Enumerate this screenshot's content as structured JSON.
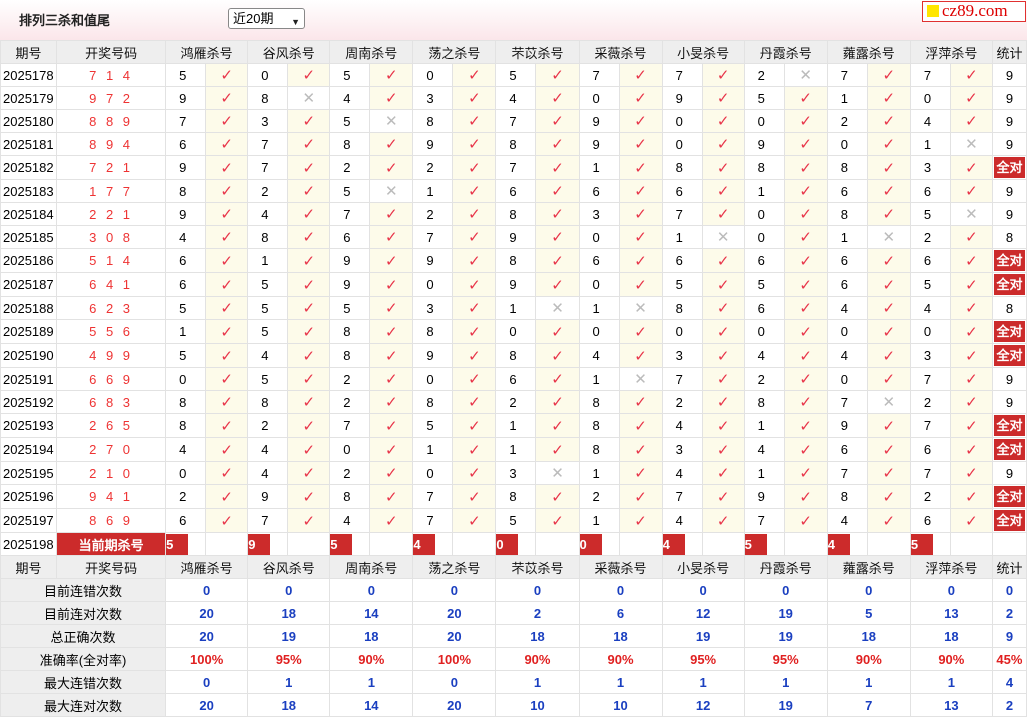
{
  "header": {
    "title": "排列三杀和值尾",
    "period_select": "近20期",
    "logo": "cz89.com"
  },
  "columns": {
    "period": "期号",
    "draw": "开奖号码",
    "experts": [
      "鸿雁杀号",
      "谷风杀号",
      "周南杀号",
      "荡之杀号",
      "芣苡杀号",
      "采薇杀号",
      "小旻杀号",
      "丹霞杀号",
      "蕹露杀号",
      "浮萍杀号"
    ],
    "stat": "统计"
  },
  "rows": [
    {
      "period": "2025178",
      "draw": "7 1 4",
      "nums": [
        "5",
        "0",
        "5",
        "0",
        "5",
        "7",
        "7",
        "2",
        "7",
        "7"
      ],
      "hits": [
        1,
        1,
        1,
        1,
        1,
        1,
        1,
        0,
        1,
        1
      ],
      "stat": "9"
    },
    {
      "period": "2025179",
      "draw": "9 7 2",
      "nums": [
        "9",
        "8",
        "4",
        "3",
        "4",
        "0",
        "9",
        "5",
        "1",
        "0"
      ],
      "hits": [
        1,
        0,
        1,
        1,
        1,
        1,
        1,
        1,
        1,
        1
      ],
      "stat": "9"
    },
    {
      "period": "2025180",
      "draw": "8 8 9",
      "nums": [
        "7",
        "3",
        "5",
        "8",
        "7",
        "9",
        "0",
        "0",
        "2",
        "4"
      ],
      "hits": [
        1,
        1,
        0,
        1,
        1,
        1,
        1,
        1,
        1,
        1
      ],
      "stat": "9"
    },
    {
      "period": "2025181",
      "draw": "8 9 4",
      "nums": [
        "6",
        "7",
        "8",
        "9",
        "8",
        "9",
        "0",
        "9",
        "0",
        "1"
      ],
      "hits": [
        1,
        1,
        1,
        1,
        1,
        1,
        1,
        1,
        1,
        0
      ],
      "stat": "9"
    },
    {
      "period": "2025182",
      "draw": "7 2 1",
      "nums": [
        "9",
        "7",
        "2",
        "2",
        "7",
        "1",
        "8",
        "8",
        "8",
        "3"
      ],
      "hits": [
        1,
        1,
        1,
        1,
        1,
        1,
        1,
        1,
        1,
        1
      ],
      "stat": "全对"
    },
    {
      "period": "2025183",
      "draw": "1 7 7",
      "nums": [
        "8",
        "2",
        "5",
        "1",
        "6",
        "6",
        "6",
        "1",
        "6",
        "6"
      ],
      "hits": [
        1,
        1,
        0,
        1,
        1,
        1,
        1,
        1,
        1,
        1
      ],
      "stat": "9"
    },
    {
      "period": "2025184",
      "draw": "2 2 1",
      "nums": [
        "9",
        "4",
        "7",
        "2",
        "8",
        "3",
        "7",
        "0",
        "8",
        "5"
      ],
      "hits": [
        1,
        1,
        1,
        1,
        1,
        1,
        1,
        1,
        1,
        0
      ],
      "stat": "9"
    },
    {
      "period": "2025185",
      "draw": "3 0 8",
      "nums": [
        "4",
        "8",
        "6",
        "7",
        "9",
        "0",
        "1",
        "0",
        "1",
        "2"
      ],
      "hits": [
        1,
        1,
        1,
        1,
        1,
        1,
        0,
        1,
        0,
        1
      ],
      "stat": "8"
    },
    {
      "period": "2025186",
      "draw": "5 1 4",
      "nums": [
        "6",
        "1",
        "9",
        "9",
        "8",
        "6",
        "6",
        "6",
        "6",
        "6"
      ],
      "hits": [
        1,
        1,
        1,
        1,
        1,
        1,
        1,
        1,
        1,
        1
      ],
      "stat": "全对"
    },
    {
      "period": "2025187",
      "draw": "6 4 1",
      "nums": [
        "6",
        "5",
        "9",
        "0",
        "9",
        "0",
        "5",
        "5",
        "6",
        "5"
      ],
      "hits": [
        1,
        1,
        1,
        1,
        1,
        1,
        1,
        1,
        1,
        1
      ],
      "stat": "全对"
    },
    {
      "period": "2025188",
      "draw": "6 2 3",
      "nums": [
        "5",
        "5",
        "5",
        "3",
        "1",
        "1",
        "8",
        "6",
        "4",
        "4"
      ],
      "hits": [
        1,
        1,
        1,
        1,
        0,
        0,
        1,
        1,
        1,
        1
      ],
      "stat": "8"
    },
    {
      "period": "2025189",
      "draw": "5 5 6",
      "nums": [
        "1",
        "5",
        "8",
        "8",
        "0",
        "0",
        "0",
        "0",
        "0",
        "0"
      ],
      "hits": [
        1,
        1,
        1,
        1,
        1,
        1,
        1,
        1,
        1,
        1
      ],
      "stat": "全对"
    },
    {
      "period": "2025190",
      "draw": "4 9 9",
      "nums": [
        "5",
        "4",
        "8",
        "9",
        "8",
        "4",
        "3",
        "4",
        "4",
        "3"
      ],
      "hits": [
        1,
        1,
        1,
        1,
        1,
        1,
        1,
        1,
        1,
        1
      ],
      "stat": "全对"
    },
    {
      "period": "2025191",
      "draw": "6 6 9",
      "nums": [
        "0",
        "5",
        "2",
        "0",
        "6",
        "1",
        "7",
        "2",
        "0",
        "7"
      ],
      "hits": [
        1,
        1,
        1,
        1,
        1,
        0,
        1,
        1,
        1,
        1
      ],
      "stat": "9"
    },
    {
      "period": "2025192",
      "draw": "6 8 3",
      "nums": [
        "8",
        "8",
        "2",
        "8",
        "2",
        "8",
        "2",
        "8",
        "7",
        "2"
      ],
      "hits": [
        1,
        1,
        1,
        1,
        1,
        1,
        1,
        1,
        0,
        1
      ],
      "stat": "9"
    },
    {
      "period": "2025193",
      "draw": "2 6 5",
      "nums": [
        "8",
        "2",
        "7",
        "5",
        "1",
        "8",
        "4",
        "1",
        "9",
        "7"
      ],
      "hits": [
        1,
        1,
        1,
        1,
        1,
        1,
        1,
        1,
        1,
        1
      ],
      "stat": "全对"
    },
    {
      "period": "2025194",
      "draw": "2 7 0",
      "nums": [
        "4",
        "4",
        "0",
        "1",
        "1",
        "8",
        "3",
        "4",
        "6",
        "6"
      ],
      "hits": [
        1,
        1,
        1,
        1,
        1,
        1,
        1,
        1,
        1,
        1
      ],
      "stat": "全对"
    },
    {
      "period": "2025195",
      "draw": "2 1 0",
      "nums": [
        "0",
        "4",
        "2",
        "0",
        "3",
        "1",
        "4",
        "1",
        "7",
        "7"
      ],
      "hits": [
        1,
        1,
        1,
        1,
        0,
        1,
        1,
        1,
        1,
        1
      ],
      "stat": "9"
    },
    {
      "period": "2025196",
      "draw": "9 4 1",
      "nums": [
        "2",
        "9",
        "8",
        "7",
        "8",
        "2",
        "7",
        "9",
        "8",
        "2"
      ],
      "hits": [
        1,
        1,
        1,
        1,
        1,
        1,
        1,
        1,
        1,
        1
      ],
      "stat": "全对"
    },
    {
      "period": "2025197",
      "draw": "8 6 9",
      "nums": [
        "6",
        "7",
        "4",
        "7",
        "5",
        "1",
        "4",
        "7",
        "4",
        "6"
      ],
      "hits": [
        1,
        1,
        1,
        1,
        1,
        1,
        1,
        1,
        1,
        1
      ],
      "stat": "全对"
    }
  ],
  "current": {
    "period": "2025198",
    "label": "当前期杀号",
    "nums": [
      "5",
      "9",
      "5",
      "4",
      "0",
      "0",
      "4",
      "5",
      "4",
      "5"
    ]
  },
  "summary": [
    {
      "label": "目前连错次数",
      "values": [
        "0",
        "0",
        "0",
        "0",
        "0",
        "0",
        "0",
        "0",
        "0",
        "0"
      ],
      "stat": "0",
      "red": false
    },
    {
      "label": "目前连对次数",
      "values": [
        "20",
        "18",
        "14",
        "20",
        "2",
        "6",
        "12",
        "19",
        "5",
        "13"
      ],
      "stat": "2",
      "red": false
    },
    {
      "label": "总正确次数",
      "values": [
        "20",
        "19",
        "18",
        "20",
        "18",
        "18",
        "19",
        "19",
        "18",
        "18"
      ],
      "stat": "9",
      "red": false
    },
    {
      "label": "准确率(全对率)",
      "values": [
        "100%",
        "95%",
        "90%",
        "100%",
        "90%",
        "90%",
        "95%",
        "95%",
        "90%",
        "90%"
      ],
      "stat": "45%",
      "red": true
    },
    {
      "label": "最大连错次数",
      "values": [
        "0",
        "1",
        "1",
        "0",
        "1",
        "1",
        "1",
        "1",
        "1",
        "1"
      ],
      "stat": "4",
      "red": false
    },
    {
      "label": "最大连对次数",
      "values": [
        "20",
        "18",
        "14",
        "20",
        "10",
        "10",
        "12",
        "19",
        "7",
        "13"
      ],
      "stat": "2",
      "red": false
    }
  ],
  "marks": {
    "hit": "✓",
    "miss": "✕"
  },
  "colors": {
    "accent": "#cc2b2b",
    "hit": "#e8354a",
    "miss": "#bbbbbb",
    "value_blue": "#1a3fc0"
  }
}
